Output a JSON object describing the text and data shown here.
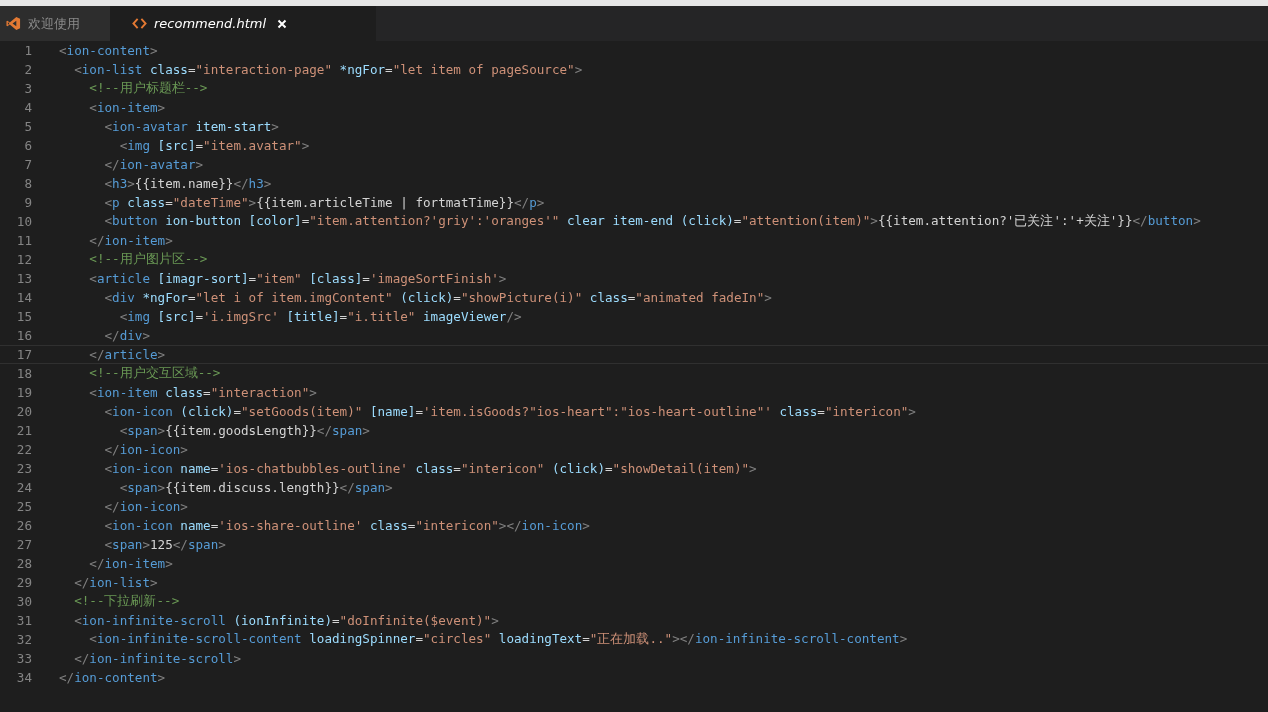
{
  "tabs": [
    {
      "kind": "welcome",
      "label": "欢迎使用",
      "selected": false,
      "closable": false
    },
    {
      "kind": "html",
      "label": "recommend.html",
      "selected": true,
      "closable": true
    }
  ],
  "lines": [
    {
      "number": "1",
      "current": false,
      "tokens": [
        {
          "kind": "punct",
          "text": "<"
        },
        {
          "kind": "tag",
          "text": "ion-content"
        },
        {
          "kind": "punct",
          "text": ">"
        }
      ]
    },
    {
      "number": "2",
      "current": false,
      "tokens": [
        {
          "kind": "punct",
          "text": "  <"
        },
        {
          "kind": "tag",
          "text": "ion-list"
        },
        {
          "kind": "attr",
          "text": " class"
        },
        {
          "kind": "plain",
          "text": "="
        },
        {
          "kind": "string",
          "text": "\"interaction-page\""
        },
        {
          "kind": "attr",
          "text": " *ngFor"
        },
        {
          "kind": "plain",
          "text": "="
        },
        {
          "kind": "string",
          "text": "\"let item of pageSource\""
        },
        {
          "kind": "punct",
          "text": ">"
        }
      ]
    },
    {
      "number": "3",
      "current": false,
      "tokens": [
        {
          "kind": "comment",
          "text": "    <!--用户标题栏-->"
        }
      ]
    },
    {
      "number": "4",
      "current": false,
      "tokens": [
        {
          "kind": "punct",
          "text": "    <"
        },
        {
          "kind": "tag",
          "text": "ion-item"
        },
        {
          "kind": "punct",
          "text": ">"
        }
      ]
    },
    {
      "number": "5",
      "current": false,
      "tokens": [
        {
          "kind": "punct",
          "text": "      <"
        },
        {
          "kind": "tag",
          "text": "ion-avatar"
        },
        {
          "kind": "attr",
          "text": " item-start"
        },
        {
          "kind": "punct",
          "text": ">"
        }
      ]
    },
    {
      "number": "6",
      "current": false,
      "tokens": [
        {
          "kind": "punct",
          "text": "        <"
        },
        {
          "kind": "tag",
          "text": "img"
        },
        {
          "kind": "attr",
          "text": " [src]"
        },
        {
          "kind": "plain",
          "text": "="
        },
        {
          "kind": "string",
          "text": "\"item.avatar\""
        },
        {
          "kind": "punct",
          "text": ">"
        }
      ]
    },
    {
      "number": "7",
      "current": false,
      "tokens": [
        {
          "kind": "punct",
          "text": "      </"
        },
        {
          "kind": "tag",
          "text": "ion-avatar"
        },
        {
          "kind": "punct",
          "text": ">"
        }
      ]
    },
    {
      "number": "8",
      "current": false,
      "tokens": [
        {
          "kind": "punct",
          "text": "      <"
        },
        {
          "kind": "tag",
          "text": "h3"
        },
        {
          "kind": "punct",
          "text": ">"
        },
        {
          "kind": "plain",
          "text": "{{item.name}}"
        },
        {
          "kind": "punct",
          "text": "</"
        },
        {
          "kind": "tag",
          "text": "h3"
        },
        {
          "kind": "punct",
          "text": ">"
        }
      ]
    },
    {
      "number": "9",
      "current": false,
      "tokens": [
        {
          "kind": "punct",
          "text": "      <"
        },
        {
          "kind": "tag",
          "text": "p"
        },
        {
          "kind": "attr",
          "text": " class"
        },
        {
          "kind": "plain",
          "text": "="
        },
        {
          "kind": "string",
          "text": "\"dateTime\""
        },
        {
          "kind": "punct",
          "text": ">"
        },
        {
          "kind": "plain",
          "text": "{{item.articleTime | fortmatTime}}"
        },
        {
          "kind": "punct",
          "text": "</"
        },
        {
          "kind": "tag",
          "text": "p"
        },
        {
          "kind": "punct",
          "text": ">"
        }
      ]
    },
    {
      "number": "10",
      "current": false,
      "tokens": [
        {
          "kind": "punct",
          "text": "      <"
        },
        {
          "kind": "tag",
          "text": "button"
        },
        {
          "kind": "attr",
          "text": " ion-button [color]"
        },
        {
          "kind": "plain",
          "text": "="
        },
        {
          "kind": "string",
          "text": "\"item.attention?'griy':'oranges'\""
        },
        {
          "kind": "attr",
          "text": " clear item-end (click)"
        },
        {
          "kind": "plain",
          "text": "="
        },
        {
          "kind": "string",
          "text": "\"attention(item)\""
        },
        {
          "kind": "punct",
          "text": ">"
        },
        {
          "kind": "plain",
          "text": "{{item.attention?'已关注':'+关注'}}"
        },
        {
          "kind": "punct",
          "text": "</"
        },
        {
          "kind": "tag",
          "text": "button"
        },
        {
          "kind": "punct",
          "text": ">"
        }
      ]
    },
    {
      "number": "11",
      "current": false,
      "tokens": [
        {
          "kind": "punct",
          "text": "    </"
        },
        {
          "kind": "tag",
          "text": "ion-item"
        },
        {
          "kind": "punct",
          "text": ">"
        }
      ]
    },
    {
      "number": "12",
      "current": false,
      "tokens": [
        {
          "kind": "comment",
          "text": "    <!--用户图片区-->"
        }
      ]
    },
    {
      "number": "13",
      "current": false,
      "tokens": [
        {
          "kind": "punct",
          "text": "    <"
        },
        {
          "kind": "tag",
          "text": "article"
        },
        {
          "kind": "attr",
          "text": " [imagr-sort]"
        },
        {
          "kind": "plain",
          "text": "="
        },
        {
          "kind": "string",
          "text": "\"item\""
        },
        {
          "kind": "attr",
          "text": " [class]"
        },
        {
          "kind": "plain",
          "text": "="
        },
        {
          "kind": "string",
          "text": "'imageSortFinish'"
        },
        {
          "kind": "punct",
          "text": ">"
        }
      ]
    },
    {
      "number": "14",
      "current": false,
      "tokens": [
        {
          "kind": "punct",
          "text": "      <"
        },
        {
          "kind": "tag",
          "text": "div"
        },
        {
          "kind": "attr",
          "text": " *ngFor"
        },
        {
          "kind": "plain",
          "text": "="
        },
        {
          "kind": "string",
          "text": "\"let i of item.imgContent\""
        },
        {
          "kind": "attr",
          "text": " (click)"
        },
        {
          "kind": "plain",
          "text": "="
        },
        {
          "kind": "string",
          "text": "\"showPicture(i)\""
        },
        {
          "kind": "attr",
          "text": " class"
        },
        {
          "kind": "plain",
          "text": "="
        },
        {
          "kind": "string",
          "text": "\"animated fadeIn\""
        },
        {
          "kind": "punct",
          "text": ">"
        }
      ]
    },
    {
      "number": "15",
      "current": false,
      "tokens": [
        {
          "kind": "punct",
          "text": "        <"
        },
        {
          "kind": "tag",
          "text": "img"
        },
        {
          "kind": "attr",
          "text": " [src]"
        },
        {
          "kind": "plain",
          "text": "="
        },
        {
          "kind": "string",
          "text": "'i.imgSrc'"
        },
        {
          "kind": "attr",
          "text": " [title]"
        },
        {
          "kind": "plain",
          "text": "="
        },
        {
          "kind": "string",
          "text": "\"i.title\""
        },
        {
          "kind": "attr",
          "text": " imageViewer"
        },
        {
          "kind": "punct",
          "text": "/>"
        }
      ]
    },
    {
      "number": "16",
      "current": false,
      "tokens": [
        {
          "kind": "punct",
          "text": "      </"
        },
        {
          "kind": "tag",
          "text": "div"
        },
        {
          "kind": "punct",
          "text": ">"
        }
      ]
    },
    {
      "number": "17",
      "current": true,
      "tokens": [
        {
          "kind": "punct",
          "text": "    </"
        },
        {
          "kind": "tag",
          "text": "article"
        },
        {
          "kind": "punct",
          "text": ">"
        }
      ]
    },
    {
      "number": "18",
      "current": false,
      "tokens": [
        {
          "kind": "comment",
          "text": "    <!--用户交互区域-->"
        }
      ]
    },
    {
      "number": "19",
      "current": false,
      "tokens": [
        {
          "kind": "punct",
          "text": "    <"
        },
        {
          "kind": "tag",
          "text": "ion-item"
        },
        {
          "kind": "attr",
          "text": " class"
        },
        {
          "kind": "plain",
          "text": "="
        },
        {
          "kind": "string",
          "text": "\"interaction\""
        },
        {
          "kind": "punct",
          "text": ">"
        }
      ]
    },
    {
      "number": "20",
      "current": false,
      "tokens": [
        {
          "kind": "punct",
          "text": "      <"
        },
        {
          "kind": "tag",
          "text": "ion-icon"
        },
        {
          "kind": "attr",
          "text": " (click)"
        },
        {
          "kind": "plain",
          "text": "="
        },
        {
          "kind": "string",
          "text": "\"setGoods(item)\""
        },
        {
          "kind": "attr",
          "text": " [name]"
        },
        {
          "kind": "plain",
          "text": "="
        },
        {
          "kind": "string",
          "text": "'item.isGoods?\"ios-heart\":\"ios-heart-outline\"'"
        },
        {
          "kind": "attr",
          "text": " class"
        },
        {
          "kind": "plain",
          "text": "="
        },
        {
          "kind": "string",
          "text": "\"intericon\""
        },
        {
          "kind": "punct",
          "text": ">"
        }
      ]
    },
    {
      "number": "21",
      "current": false,
      "tokens": [
        {
          "kind": "punct",
          "text": "        <"
        },
        {
          "kind": "tag",
          "text": "span"
        },
        {
          "kind": "punct",
          "text": ">"
        },
        {
          "kind": "plain",
          "text": "{{item.goodsLength}}"
        },
        {
          "kind": "punct",
          "text": "</"
        },
        {
          "kind": "tag",
          "text": "span"
        },
        {
          "kind": "punct",
          "text": ">"
        }
      ]
    },
    {
      "number": "22",
      "current": false,
      "tokens": [
        {
          "kind": "punct",
          "text": "      </"
        },
        {
          "kind": "tag",
          "text": "ion-icon"
        },
        {
          "kind": "punct",
          "text": ">"
        }
      ]
    },
    {
      "number": "23",
      "current": false,
      "tokens": [
        {
          "kind": "punct",
          "text": "      <"
        },
        {
          "kind": "tag",
          "text": "ion-icon"
        },
        {
          "kind": "attr",
          "text": " name"
        },
        {
          "kind": "plain",
          "text": "="
        },
        {
          "kind": "string",
          "text": "'ios-chatbubbles-outline'"
        },
        {
          "kind": "attr",
          "text": " class"
        },
        {
          "kind": "plain",
          "text": "="
        },
        {
          "kind": "string",
          "text": "\"intericon\""
        },
        {
          "kind": "attr",
          "text": " (click)"
        },
        {
          "kind": "plain",
          "text": "="
        },
        {
          "kind": "string",
          "text": "\"showDetail(item)\""
        },
        {
          "kind": "punct",
          "text": ">"
        }
      ]
    },
    {
      "number": "24",
      "current": false,
      "tokens": [
        {
          "kind": "punct",
          "text": "        <"
        },
        {
          "kind": "tag",
          "text": "span"
        },
        {
          "kind": "punct",
          "text": ">"
        },
        {
          "kind": "plain",
          "text": "{{item.discuss.length}}"
        },
        {
          "kind": "punct",
          "text": "</"
        },
        {
          "kind": "tag",
          "text": "span"
        },
        {
          "kind": "punct",
          "text": ">"
        }
      ]
    },
    {
      "number": "25",
      "current": false,
      "tokens": [
        {
          "kind": "punct",
          "text": "      </"
        },
        {
          "kind": "tag",
          "text": "ion-icon"
        },
        {
          "kind": "punct",
          "text": ">"
        }
      ]
    },
    {
      "number": "26",
      "current": false,
      "tokens": [
        {
          "kind": "punct",
          "text": "      <"
        },
        {
          "kind": "tag",
          "text": "ion-icon"
        },
        {
          "kind": "attr",
          "text": " name"
        },
        {
          "kind": "plain",
          "text": "="
        },
        {
          "kind": "string",
          "text": "'ios-share-outline'"
        },
        {
          "kind": "attr",
          "text": " class"
        },
        {
          "kind": "plain",
          "text": "="
        },
        {
          "kind": "string",
          "text": "\"intericon\""
        },
        {
          "kind": "punct",
          "text": "></"
        },
        {
          "kind": "tag",
          "text": "ion-icon"
        },
        {
          "kind": "punct",
          "text": ">"
        }
      ]
    },
    {
      "number": "27",
      "current": false,
      "tokens": [
        {
          "kind": "punct",
          "text": "      <"
        },
        {
          "kind": "tag",
          "text": "span"
        },
        {
          "kind": "punct",
          "text": ">"
        },
        {
          "kind": "plain",
          "text": "125"
        },
        {
          "kind": "punct",
          "text": "</"
        },
        {
          "kind": "tag",
          "text": "span"
        },
        {
          "kind": "punct",
          "text": ">"
        }
      ]
    },
    {
      "number": "28",
      "current": false,
      "tokens": [
        {
          "kind": "punct",
          "text": "    </"
        },
        {
          "kind": "tag",
          "text": "ion-item"
        },
        {
          "kind": "punct",
          "text": ">"
        }
      ]
    },
    {
      "number": "29",
      "current": false,
      "tokens": [
        {
          "kind": "punct",
          "text": "  </"
        },
        {
          "kind": "tag",
          "text": "ion-list"
        },
        {
          "kind": "punct",
          "text": ">"
        }
      ]
    },
    {
      "number": "30",
      "current": false,
      "tokens": [
        {
          "kind": "comment",
          "text": "  <!--下拉刷新-->"
        }
      ]
    },
    {
      "number": "31",
      "current": false,
      "tokens": [
        {
          "kind": "punct",
          "text": "  <"
        },
        {
          "kind": "tag",
          "text": "ion-infinite-scroll"
        },
        {
          "kind": "attr",
          "text": " (ionInfinite)"
        },
        {
          "kind": "plain",
          "text": "="
        },
        {
          "kind": "string",
          "text": "\"doInfinite($event)\""
        },
        {
          "kind": "punct",
          "text": ">"
        }
      ]
    },
    {
      "number": "32",
      "current": false,
      "tokens": [
        {
          "kind": "punct",
          "text": "    <"
        },
        {
          "kind": "tag",
          "text": "ion-infinite-scroll-content"
        },
        {
          "kind": "attr",
          "text": " loadingSpinner"
        },
        {
          "kind": "plain",
          "text": "="
        },
        {
          "kind": "string",
          "text": "\"circles\""
        },
        {
          "kind": "attr",
          "text": " loadingText"
        },
        {
          "kind": "plain",
          "text": "="
        },
        {
          "kind": "string",
          "text": "\"正在加载..\""
        },
        {
          "kind": "punct",
          "text": "></"
        },
        {
          "kind": "tag",
          "text": "ion-infinite-scroll-content"
        },
        {
          "kind": "punct",
          "text": ">"
        }
      ]
    },
    {
      "number": "33",
      "current": false,
      "tokens": [
        {
          "kind": "punct",
          "text": "  </"
        },
        {
          "kind": "tag",
          "text": "ion-infinite-scroll"
        },
        {
          "kind": "punct",
          "text": ">"
        }
      ]
    },
    {
      "number": "34",
      "current": false,
      "tokens": [
        {
          "kind": "punct",
          "text": "</"
        },
        {
          "kind": "tag",
          "text": "ion-content"
        },
        {
          "kind": "punct",
          "text": ">"
        }
      ]
    }
  ]
}
